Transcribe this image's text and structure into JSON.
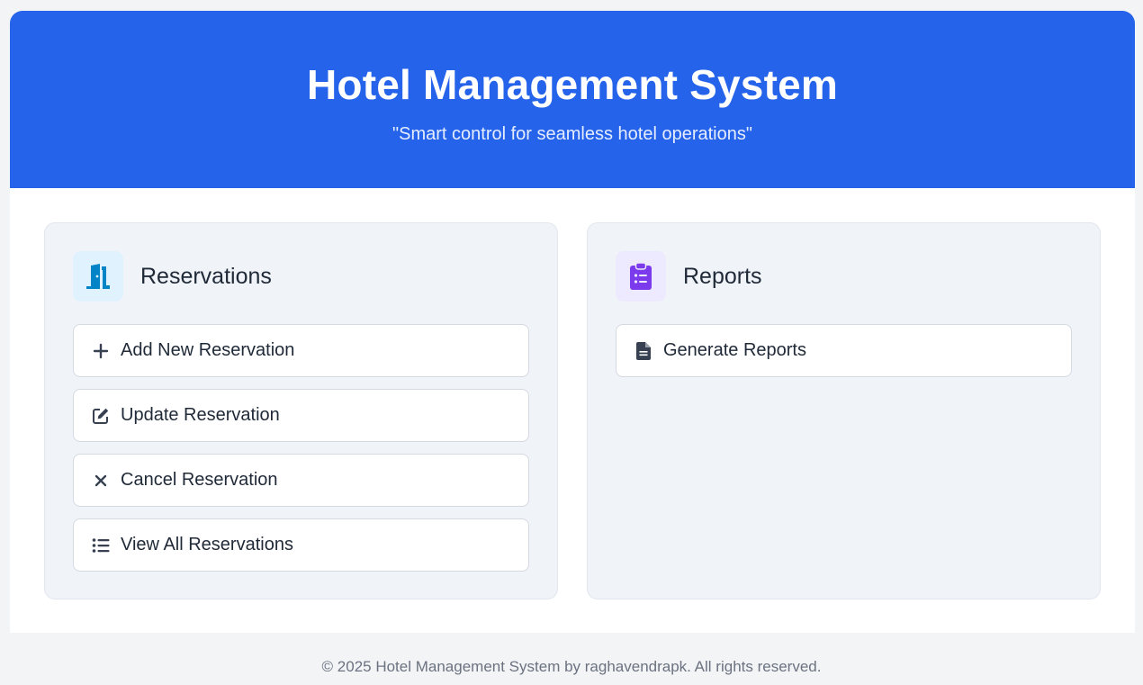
{
  "header": {
    "title": "Hotel Management System",
    "subtitle": "\"Smart control for seamless hotel operations\""
  },
  "reservations": {
    "title": "Reservations",
    "icon": "door-open-icon",
    "accent": "#0284c7",
    "actions": [
      {
        "label": "Add New Reservation",
        "icon": "plus-icon"
      },
      {
        "label": "Update Reservation",
        "icon": "edit-icon"
      },
      {
        "label": "Cancel Reservation",
        "icon": "close-icon"
      },
      {
        "label": "View All Reservations",
        "icon": "list-icon"
      }
    ]
  },
  "reports": {
    "title": "Reports",
    "icon": "clipboard-list-icon",
    "accent": "#7c3aed",
    "actions": [
      {
        "label": "Generate Reports",
        "icon": "file-icon"
      }
    ]
  },
  "footer": {
    "text": "© 2025 Hotel Management System by raghavendrapk. All rights reserved."
  },
  "colors": {
    "header_bg": "#2563eb",
    "card_bg": "#f0f3f8",
    "page_bg": "#f3f4f6"
  }
}
